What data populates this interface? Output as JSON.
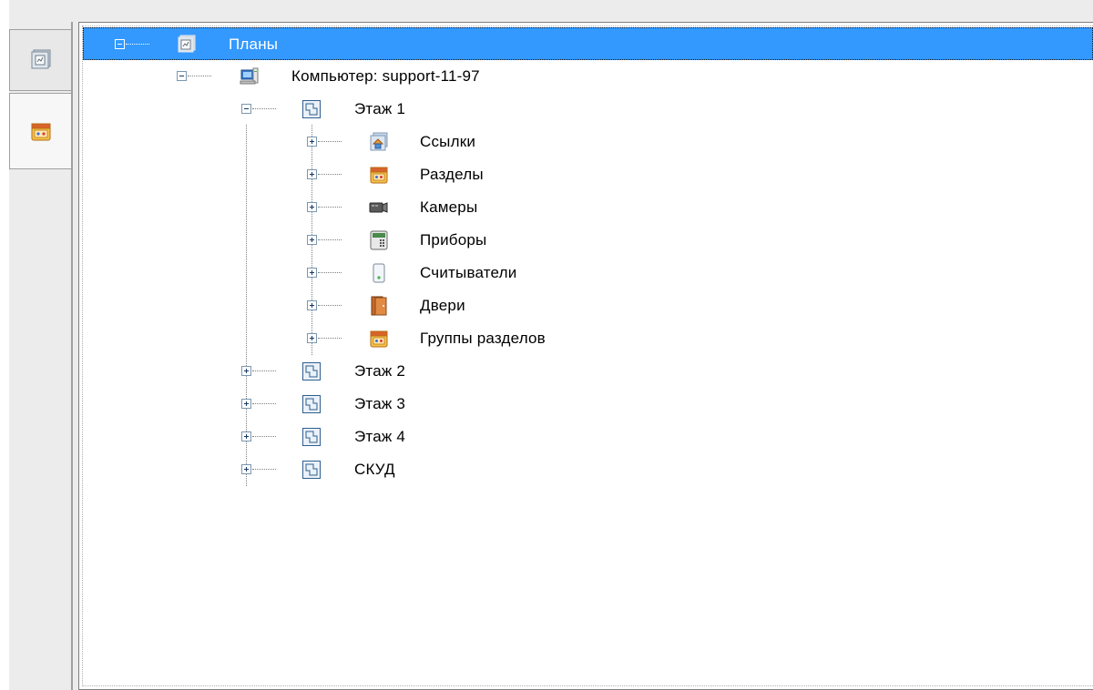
{
  "sidebar": {
    "tabs": [
      {
        "name": "plans-tab",
        "icon": "plans-icon"
      },
      {
        "name": "sections-tab",
        "icon": "sections-icon"
      }
    ]
  },
  "tree": {
    "root": {
      "label": "Планы",
      "icon": "plans-icon",
      "expanded": true,
      "selected": true
    },
    "computer": {
      "label": "Компьютер: support-11-97",
      "icon": "computer-icon",
      "expanded": true
    },
    "floor1": {
      "label": "Этаж 1",
      "icon": "floor-plan-icon",
      "expanded": true,
      "children": [
        {
          "label": "Ссылки",
          "icon": "links-icon"
        },
        {
          "label": "Разделы",
          "icon": "sections-icon"
        },
        {
          "label": "Камеры",
          "icon": "camera-icon"
        },
        {
          "label": "Приборы",
          "icon": "device-icon"
        },
        {
          "label": "Считыватели",
          "icon": "reader-icon"
        },
        {
          "label": "Двери",
          "icon": "door-icon"
        },
        {
          "label": "Группы разделов",
          "icon": "section-groups-icon"
        }
      ]
    },
    "floors": [
      {
        "label": "Этаж 2",
        "icon": "floor-plan-icon"
      },
      {
        "label": "Этаж 3",
        "icon": "floor-plan-icon"
      },
      {
        "label": "Этаж 4",
        "icon": "floor-plan-icon"
      },
      {
        "label": "СКУД",
        "icon": "floor-plan-icon"
      }
    ]
  },
  "colors": {
    "selection": "#3399ff",
    "background": "#ececec",
    "tree_background": "#ffffff"
  }
}
